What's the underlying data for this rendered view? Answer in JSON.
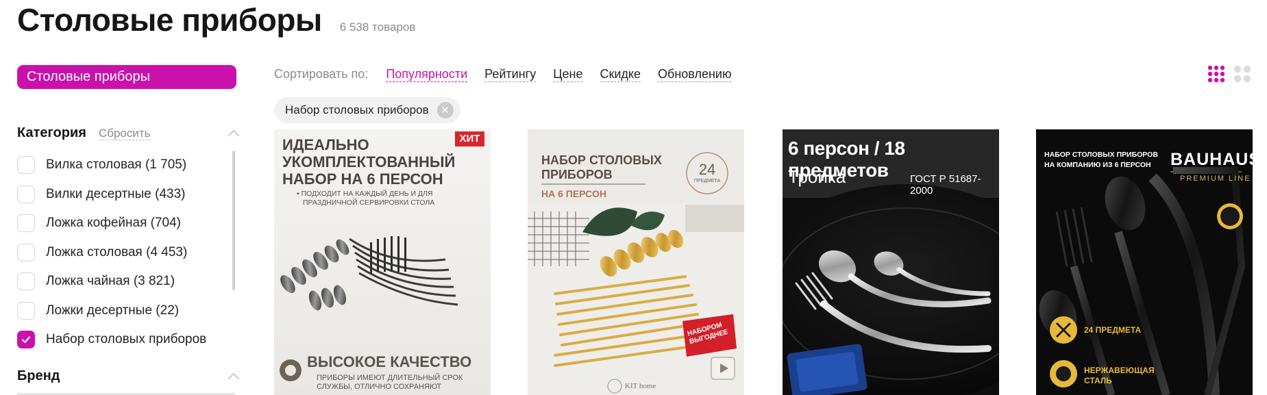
{
  "header": {
    "title": "Столовые приборы",
    "count": "6 538 товаров"
  },
  "sidebar": {
    "active_category": "Столовые приборы",
    "category_filter": {
      "title": "Категория",
      "reset": "Сбросить",
      "items": [
        {
          "label": "Вилка столовая (1 705)",
          "checked": false
        },
        {
          "label": "Вилки десертные (433)",
          "checked": false
        },
        {
          "label": "Ложка кофейная (704)",
          "checked": false
        },
        {
          "label": "Ложка столовая (4 453)",
          "checked": false
        },
        {
          "label": "Ложка чайная (3 821)",
          "checked": false
        },
        {
          "label": "Ложки десертные (22)",
          "checked": false
        },
        {
          "label": "Набор столовых приборов",
          "checked": true
        }
      ]
    },
    "brand_filter": {
      "title": "Бренд"
    }
  },
  "sort": {
    "label": "Сортировать по:",
    "options": [
      "Популярности",
      "Рейтингу",
      "Цене",
      "Скидке",
      "Обновлению"
    ],
    "active": "Популярности"
  },
  "active_filter_chip": {
    "label": "Набор столовых приборов"
  },
  "view_modes": [
    "grid-small-icon",
    "grid-large-icon"
  ],
  "colors": {
    "accent": "#cb11ab",
    "text": "#242424",
    "muted": "#8b8b8b"
  },
  "products": [
    {
      "badge": "ХИТ",
      "headline": [
        "ИДЕАЛЬНО",
        "УКОМПЛЕКТОВАННЫЙ",
        "НАБОР НА 6 ПЕРСОН"
      ],
      "bullet": [
        "• ПОДХОДИТ НА КАЖДЫЙ ДЕНЬ И ДЛЯ",
        "ПРАЗДНИЧНОЙ СЕРВИРОВКИ СТОЛА"
      ],
      "quality": "ВЫСОКОЕ КАЧЕСТВО",
      "quality_note": [
        "ПРИБОРЫ ИМЕЮТ ДЛИТЕЛЬНЫЙ СРОК",
        "СЛУЖБЫ, ОТЛИЧНО СОХРАНЯЮТ"
      ]
    },
    {
      "headline": [
        "НАБОР СТОЛОВЫХ",
        "ПРИБОРОВ"
      ],
      "sub": "НА 6 ПЕРСОН",
      "count_number": "24",
      "count_unit": "ПРЕДМЕТА",
      "tag": [
        "НАБОРОМ",
        "ВЫГОДНЕЕ"
      ],
      "logo": "KIT home"
    },
    {
      "headline": "6 персон / 18 предметов",
      "brand": "Тройка",
      "standard": "ГОСТ Р 51687-2000"
    },
    {
      "headline": [
        "НАБОР СТОЛОВЫХ ПРИБОРОВ",
        "НА КОМПАНИЮ ИЗ 6 ПЕРСОН"
      ],
      "brand": "BAUHAUS",
      "line": "PREMIUM LINE",
      "feature1": "24 ПРЕДМЕТА",
      "feature2": [
        "НЕРЖАВЕЮЩАЯ",
        "СТАЛЬ"
      ]
    }
  ]
}
